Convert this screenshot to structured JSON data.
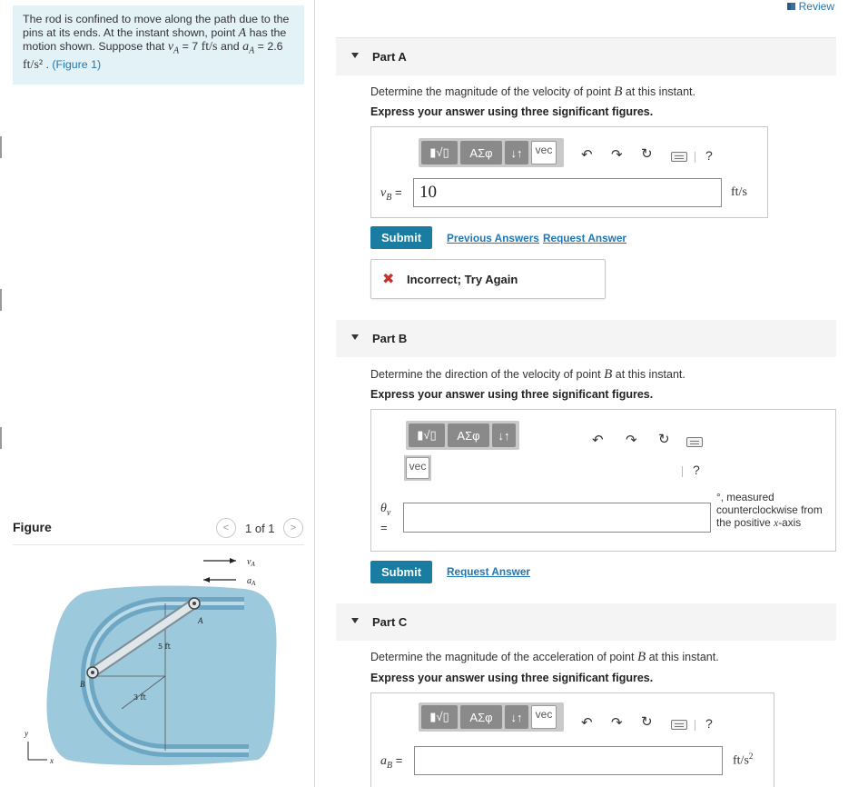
{
  "problem": {
    "text_1": "The rod is confined to move along the path due to the pins at its ends. At the instant shown, point",
    "point_a": "A",
    "text_2": "has the motion shown. Suppose that",
    "va_expr": "v",
    "va_sub": "A",
    "va_value": " = 7 ",
    "va_unit": "ft/s",
    "text_3": "and",
    "aa_expr": "a",
    "aa_sub": "A",
    "aa_value": " = 2.6 ",
    "aa_unit": "ft/s²",
    "period": " . ",
    "figure_link": "(Figure 1)"
  },
  "figure": {
    "label": "Figure",
    "pager": "1 of 1",
    "prev_icon": "chevron-left-icon",
    "next_icon": "chevron-right-icon",
    "labels": {
      "va": "v",
      "va_sub": "A",
      "aa": "a",
      "aa_sub": "A",
      "point_a": "A",
      "point_b": "B",
      "dim_5": "5 ft",
      "dim_3": "3 ft",
      "axis_y": "y",
      "axis_x": "x"
    },
    "colors": {
      "plate": "#9cc9dc",
      "slot": "#6ea7c4",
      "rod": "#c8d4da"
    }
  },
  "review": {
    "label": "Review",
    "icon": "book-icon"
  },
  "toolbar": {
    "templates_label": "▮√▯",
    "greek_label": "ΑΣφ",
    "arrows_label": "↓↑",
    "vec_label": "vec",
    "undo_icon": "undo-icon",
    "redo_icon": "redo-icon",
    "reset_icon": "reset-icon",
    "keyboard_icon": "keyboard-icon",
    "help_label": "?"
  },
  "partA": {
    "title": "Part A",
    "question_1": "Determine the magnitude of the velocity of point ",
    "point": "B",
    "question_2": " at this instant.",
    "instruction": "Express your answer using three significant figures.",
    "var": "v",
    "var_sub": "B",
    "eq": " = ",
    "value": "10",
    "unit": "ft/s",
    "submit": "Submit",
    "previous_answers": "Previous Answers",
    "request_answer": "Request Answer",
    "feedback": "Incorrect; Try Again"
  },
  "partB": {
    "title": "Part B",
    "question_1": "Determine the direction of the velocity of point ",
    "point": "B",
    "question_2": " at this instant.",
    "instruction": "Express your answer using three significant figures.",
    "var": "θ",
    "var_sub": "v",
    "eq": "=",
    "value": "",
    "unit_1": "°, measured counterclockwise from the positive ",
    "unit_x": "x",
    "unit_2": "-axis",
    "submit": "Submit",
    "request_answer": "Request Answer"
  },
  "partC": {
    "title": "Part C",
    "question_1": "Determine the magnitude of the acceleration of point ",
    "point": "B",
    "question_2": " at this instant.",
    "instruction": "Express your answer using three significant figures.",
    "var": "a",
    "var_sub": "B",
    "eq": " = ",
    "value": "",
    "unit": "ft/s",
    "unit_sup": "2"
  }
}
